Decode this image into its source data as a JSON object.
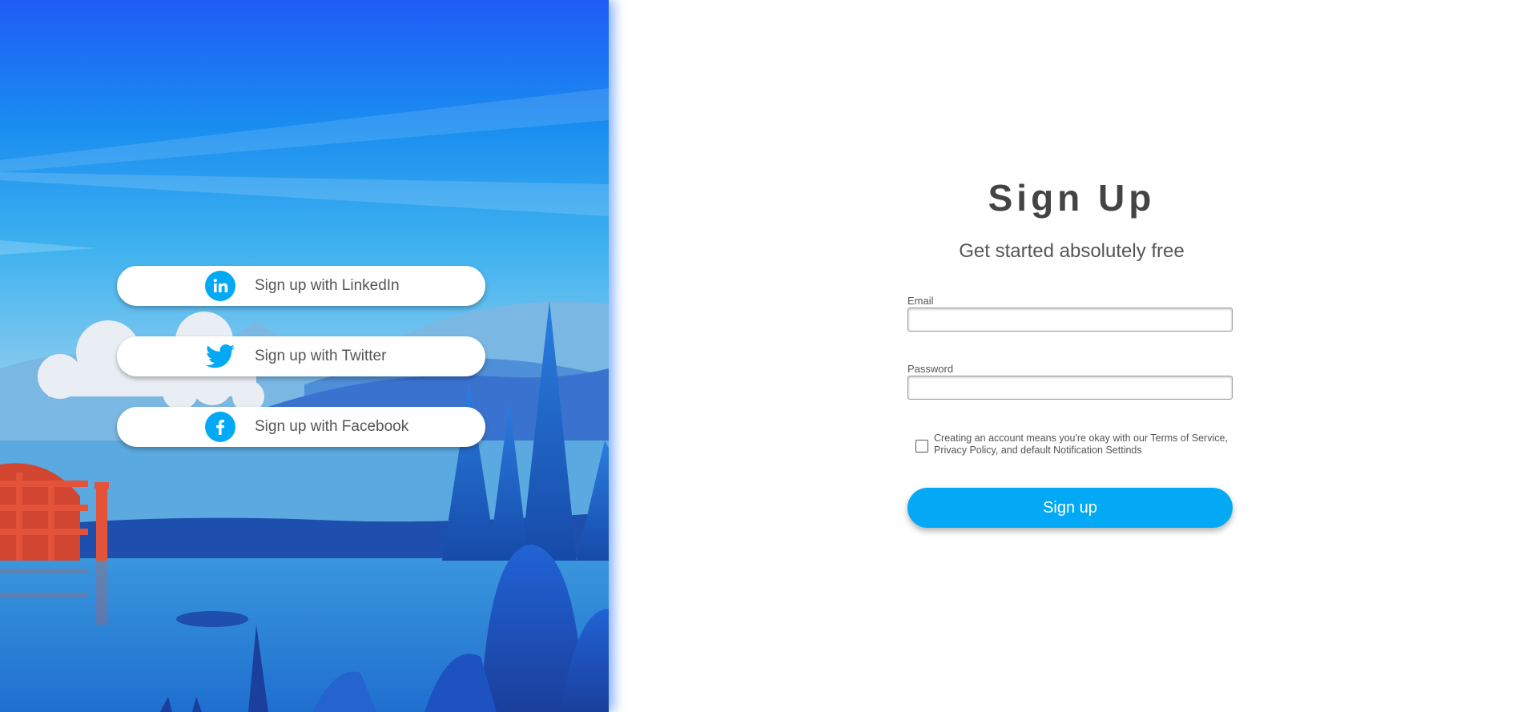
{
  "social": {
    "buttons": [
      {
        "label": "Sign up with LinkedIn",
        "icon": "linkedin-icon"
      },
      {
        "label": "Sign up with Twitter",
        "icon": "twitter-icon"
      },
      {
        "label": "Sign up with Facebook",
        "icon": "facebook-icon"
      }
    ],
    "icon_color": "#03a9f4"
  },
  "form": {
    "title": "Sign Up",
    "subtitle": "Get started absolutely free",
    "email_label": "Email",
    "email_value": "",
    "password_label": "Password",
    "password_value": "",
    "terms_text": "Creating an account means you're okay with our Terms of Service, Privacy Policy, and default Notification Settinds",
    "terms_checked": false,
    "submit_label": "Sign up",
    "accent_color": "#03a9f4"
  }
}
